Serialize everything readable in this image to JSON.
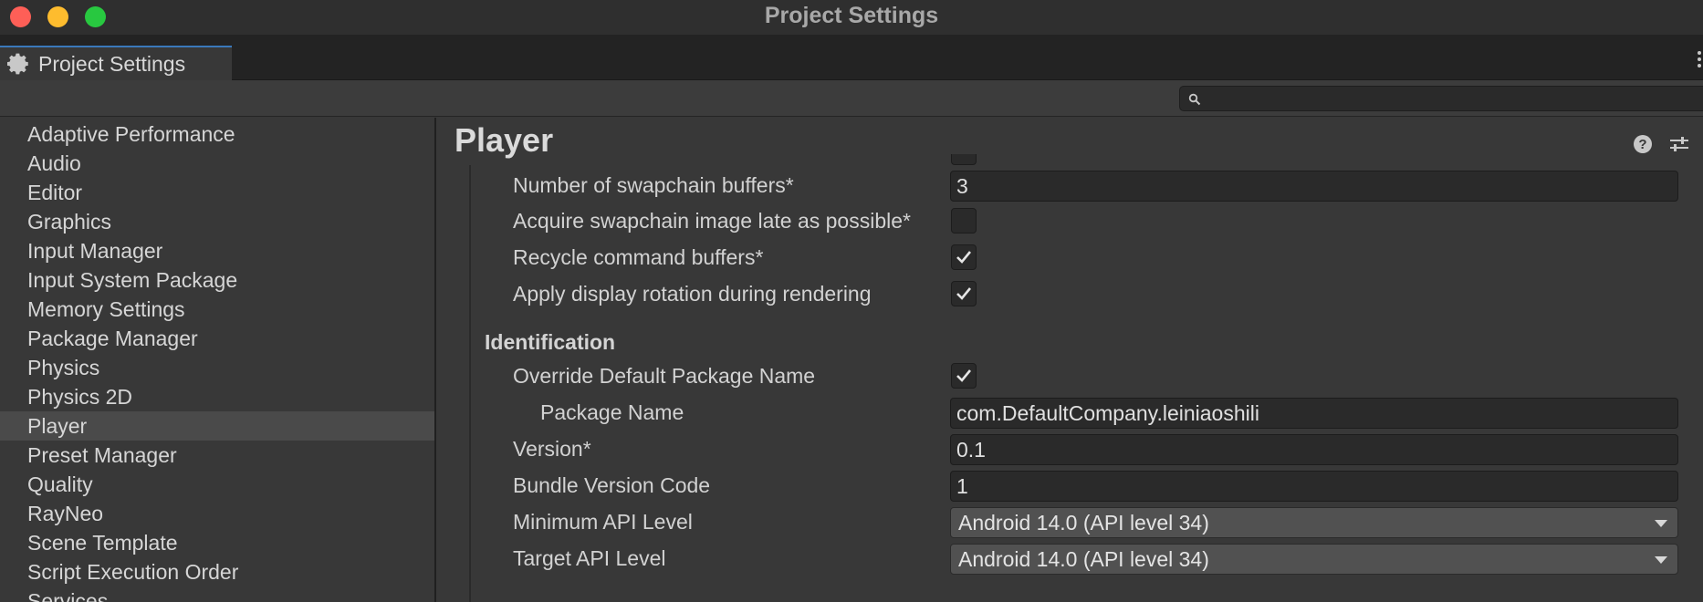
{
  "window": {
    "title": "Project Settings"
  },
  "tab": {
    "label": "Project Settings",
    "icon": "gear-icon"
  },
  "search": {
    "value": "",
    "placeholder": ""
  },
  "sidebar": {
    "items": [
      {
        "label": "Adaptive Performance"
      },
      {
        "label": "Audio"
      },
      {
        "label": "Editor"
      },
      {
        "label": "Graphics"
      },
      {
        "label": "Input Manager"
      },
      {
        "label": "Input System Package"
      },
      {
        "label": "Memory Settings"
      },
      {
        "label": "Package Manager"
      },
      {
        "label": "Physics"
      },
      {
        "label": "Physics 2D"
      },
      {
        "label": "Player",
        "selected": true
      },
      {
        "label": "Preset Manager"
      },
      {
        "label": "Quality"
      },
      {
        "label": "RayNeo"
      },
      {
        "label": "Scene Template"
      },
      {
        "label": "Script Execution Order"
      },
      {
        "label": "Services"
      }
    ]
  },
  "main": {
    "title": "Player",
    "swapchain_buffers": {
      "label": "Number of swapchain buffers*",
      "value": "3"
    },
    "acquire_late": {
      "label": "Acquire swapchain image late as possible*",
      "checked": false
    },
    "recycle_buffers": {
      "label": "Recycle command buffers*",
      "checked": true
    },
    "display_rotation": {
      "label": "Apply display rotation during rendering",
      "checked": true
    },
    "identification": {
      "header": "Identification",
      "override_package": {
        "label": "Override Default Package Name",
        "checked": true
      },
      "package_name": {
        "label": "Package Name",
        "value": "com.DefaultCompany.leiniaoshili"
      },
      "version": {
        "label": "Version*",
        "value": "0.1"
      },
      "bundle_code": {
        "label": "Bundle Version Code",
        "value": "1"
      },
      "min_api": {
        "label": "Minimum API Level",
        "value": "Android 14.0 (API level 34)"
      },
      "target_api": {
        "label": "Target API Level",
        "value": "Android 14.0 (API level 34)"
      }
    }
  }
}
